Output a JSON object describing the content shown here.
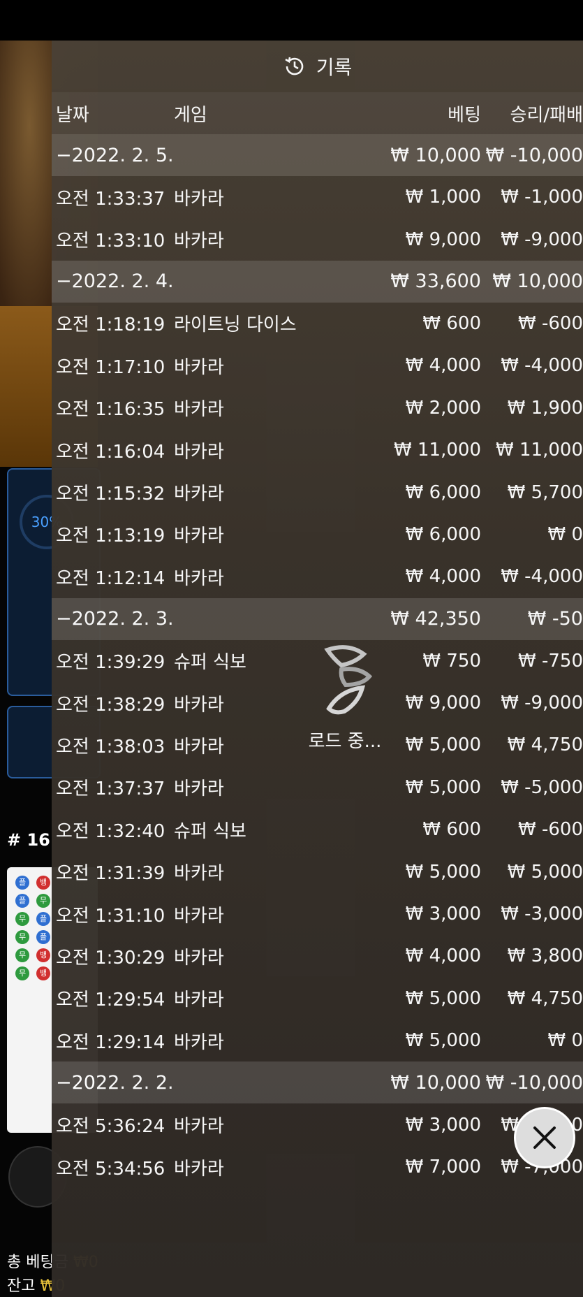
{
  "panel": {
    "title": "기록",
    "columns": {
      "date": "날짜",
      "game": "게임",
      "bet": "베팅",
      "win": "승리/패배"
    }
  },
  "groups": [
    {
      "date": "−2022. 2. 5.",
      "bet": "₩ 10,000",
      "win": "₩ -10,000",
      "rows": [
        {
          "time": "오전 1:33:37",
          "game": "바카라",
          "bet": "₩ 1,000",
          "win": "₩ -1,000"
        },
        {
          "time": "오전 1:33:10",
          "game": "바카라",
          "bet": "₩ 9,000",
          "win": "₩ -9,000"
        }
      ]
    },
    {
      "date": "−2022. 2. 4.",
      "bet": "₩ 33,600",
      "win": "₩ 10,000",
      "rows": [
        {
          "time": "오전 1:18:19",
          "game": "라이트닝 다이스",
          "bet": "₩ 600",
          "win": "₩ -600"
        },
        {
          "time": "오전 1:17:10",
          "game": "바카라",
          "bet": "₩ 4,000",
          "win": "₩ -4,000"
        },
        {
          "time": "오전 1:16:35",
          "game": "바카라",
          "bet": "₩ 2,000",
          "win": "₩ 1,900"
        },
        {
          "time": "오전 1:16:04",
          "game": "바카라",
          "bet": "₩ 11,000",
          "win": "₩ 11,000"
        },
        {
          "time": "오전 1:15:32",
          "game": "바카라",
          "bet": "₩ 6,000",
          "win": "₩ 5,700"
        },
        {
          "time": "오전 1:13:19",
          "game": "바카라",
          "bet": "₩ 6,000",
          "win": "₩ 0"
        },
        {
          "time": "오전 1:12:14",
          "game": "바카라",
          "bet": "₩ 4,000",
          "win": "₩ -4,000"
        }
      ]
    },
    {
      "date": "−2022. 2. 3.",
      "bet": "₩ 42,350",
      "win": "₩ -50",
      "rows": [
        {
          "time": "오전 1:39:29",
          "game": "슈퍼 식보",
          "bet": "₩ 750",
          "win": "₩ -750"
        },
        {
          "time": "오전 1:38:29",
          "game": "바카라",
          "bet": "₩ 9,000",
          "win": "₩ -9,000"
        },
        {
          "time": "오전 1:38:03",
          "game": "바카라",
          "bet": "₩ 5,000",
          "win": "₩ 4,750"
        },
        {
          "time": "오전 1:37:37",
          "game": "바카라",
          "bet": "₩ 5,000",
          "win": "₩ -5,000"
        },
        {
          "time": "오전 1:32:40",
          "game": "슈퍼 식보",
          "bet": "₩ 600",
          "win": "₩ -600"
        },
        {
          "time": "오전 1:31:39",
          "game": "바카라",
          "bet": "₩ 5,000",
          "win": "₩ 5,000"
        },
        {
          "time": "오전 1:31:10",
          "game": "바카라",
          "bet": "₩ 3,000",
          "win": "₩ -3,000"
        },
        {
          "time": "오전 1:30:29",
          "game": "바카라",
          "bet": "₩ 4,000",
          "win": "₩ 3,800"
        },
        {
          "time": "오전 1:29:54",
          "game": "바카라",
          "bet": "₩ 5,000",
          "win": "₩ 4,750"
        },
        {
          "time": "오전 1:29:14",
          "game": "바카라",
          "bet": "₩ 5,000",
          "win": "₩ 0"
        }
      ]
    },
    {
      "date": "−2022. 2. 2.",
      "bet": "₩ 10,000",
      "win": "₩ -10,000",
      "rows": [
        {
          "time": "오전 5:36:24",
          "game": "바카라",
          "bet": "₩ 3,000",
          "win": "₩ -3,000"
        },
        {
          "time": "오전 5:34:56",
          "game": "바카라",
          "bet": "₩ 7,000",
          "win": "₩ -7,000"
        }
      ]
    }
  ],
  "loader": {
    "text": "로드 중..."
  },
  "background": {
    "percent": "30%",
    "round_number": "# 16",
    "total_bet_label": "총 베팅금",
    "total_bet_value": "₩0",
    "balance_label": "잔고",
    "balance_value": "₩0"
  },
  "colors": {
    "accent_yellow": "#e8c23a",
    "panel_bg": "#3b342c",
    "table_blue": "#2a5c9c"
  },
  "icons": {
    "title_icon": "history-clock-icon",
    "close": "close-icon",
    "loader": "evolution-logo-spinner-icon"
  }
}
